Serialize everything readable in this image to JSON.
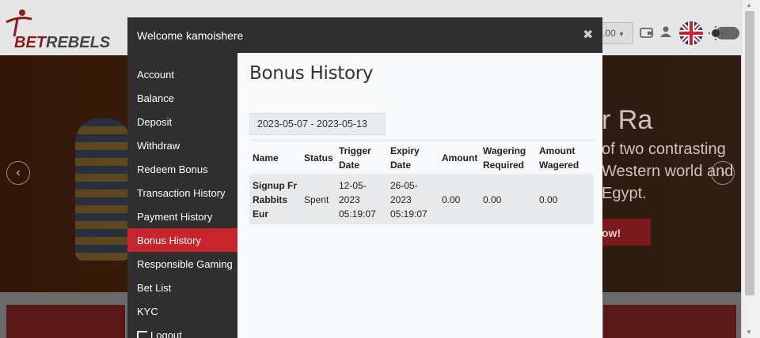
{
  "site": {
    "logo_text_a": "BET",
    "logo_text_b": "REBELS",
    "balance_value": ".00",
    "hero_title": "r Ra",
    "hero_lines": [
      "of two contrasting",
      "Western world and",
      "Egypt."
    ],
    "hero_button": "ow!",
    "prev_arrow": "‹",
    "next_arrow": "›"
  },
  "modal": {
    "title": "Welcome kamoishere",
    "close_symbol": "✖",
    "menu": [
      {
        "label": "Account",
        "active": false
      },
      {
        "label": "Balance",
        "active": false
      },
      {
        "label": "Deposit",
        "active": false
      },
      {
        "label": "Withdraw",
        "active": false
      },
      {
        "label": "Redeem Bonus",
        "active": false
      },
      {
        "label": "Transaction History",
        "active": false
      },
      {
        "label": "Payment History",
        "active": false
      },
      {
        "label": "Bonus History",
        "active": true
      },
      {
        "label": "Responsible Gaming",
        "active": false
      },
      {
        "label": "Bet List",
        "active": false
      },
      {
        "label": "KYC",
        "active": false
      },
      {
        "label": "Logout",
        "active": false
      }
    ],
    "content": {
      "page_title": "Bonus History",
      "date_range": "2023-05-07 - 2023-05-13",
      "columns": {
        "name": "Name",
        "status": "Status",
        "trigger_1": "Trigger",
        "trigger_2": "Date",
        "expiry_1": "Expiry",
        "expiry_2": "Date",
        "amount": "Amount",
        "wagering_1": "Wagering",
        "wagering_2": "Required",
        "wagered_1": "Amount",
        "wagered_2": "Wagered"
      },
      "rows": [
        {
          "name_1": "Signup Fr",
          "name_2": "Rabbits",
          "name_3": "Eur",
          "status": "Spent",
          "trigger_1": "12-05-",
          "trigger_2": "2023",
          "trigger_3": "05:19:07",
          "expiry_1": "26-05-",
          "expiry_2": "2023",
          "expiry_3": "05:19:07",
          "amount": "0.00",
          "wagering_required": "0.00",
          "amount_wagered": "0.00"
        }
      ]
    }
  },
  "colors": {
    "modal_header": "#2f2f2f",
    "menu_active": "#c8262c",
    "content_bg": "#f8f9fa"
  }
}
